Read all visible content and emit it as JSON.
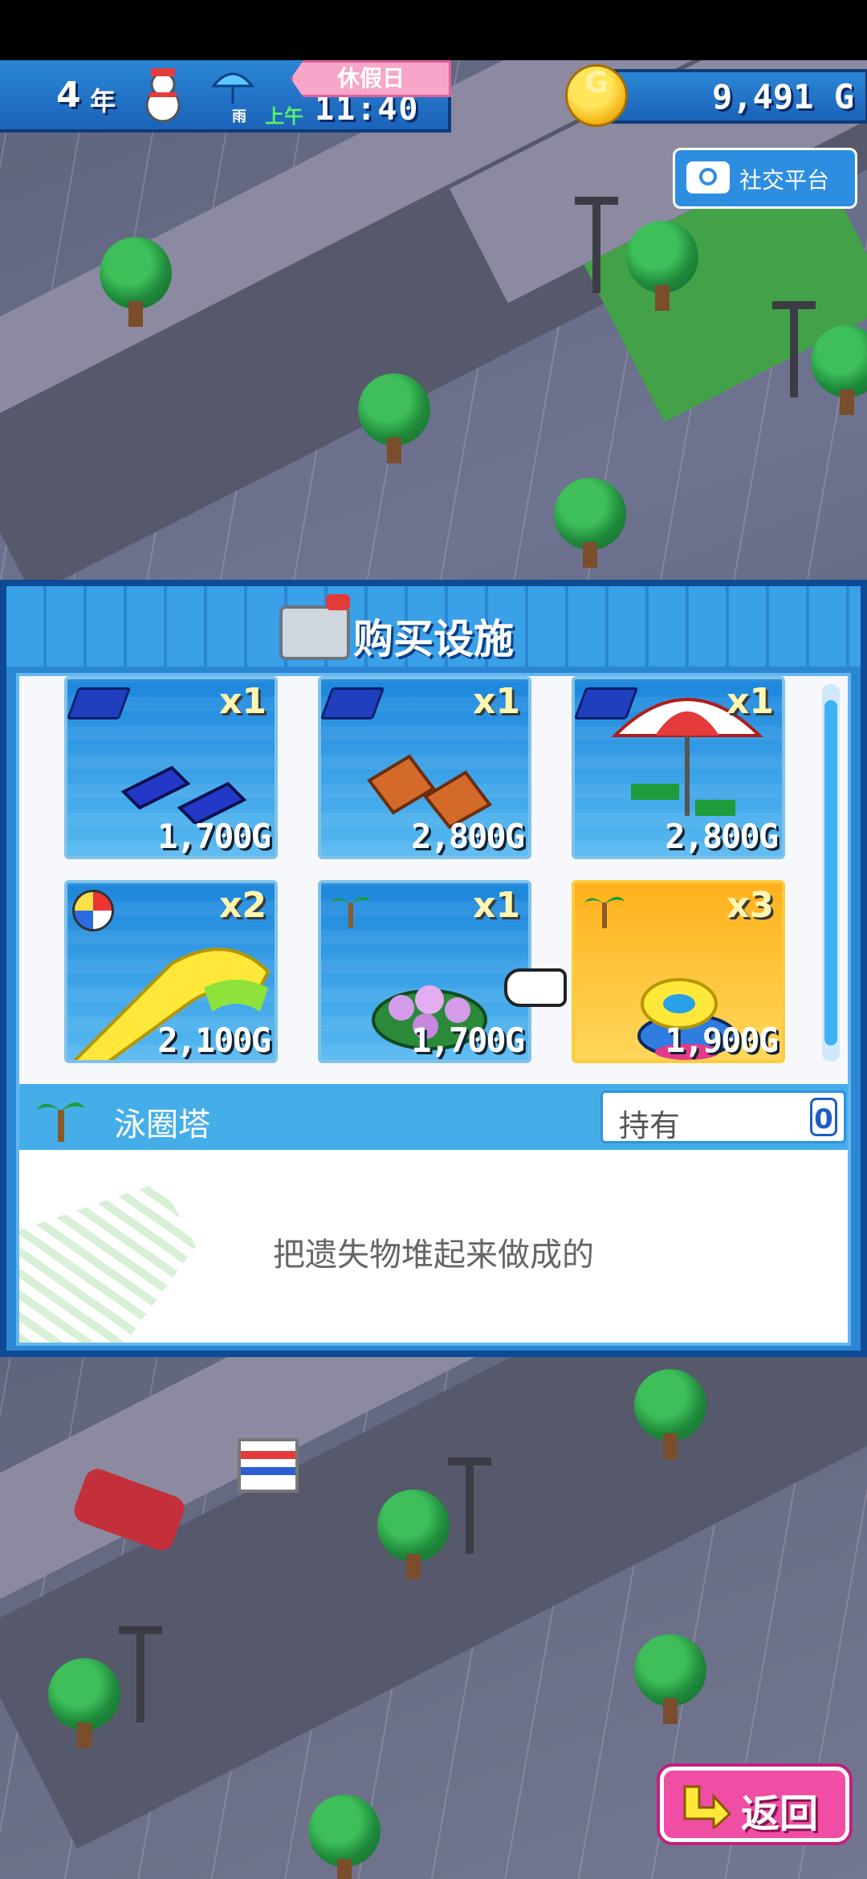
{
  "hud": {
    "year": "4",
    "year_unit": "年",
    "weather": "雨",
    "ampm": "上午",
    "time": "11:40",
    "holiday": "休假日",
    "money": "9,491 G",
    "coin_symbol": "G",
    "icons": [
      "snowman-icon",
      "umbrella-icon",
      "coin-icon"
    ]
  },
  "social": {
    "label": "社交平台",
    "icon": "camera-icon"
  },
  "modal": {
    "title": "购买设施",
    "items": [
      {
        "qty": "x1",
        "price": "1,700G",
        "category_icon": "beach-chair-icon"
      },
      {
        "qty": "x1",
        "price": "2,800G",
        "category_icon": "beach-chair-icon"
      },
      {
        "qty": "x1",
        "price": "2,800G",
        "category_icon": "beach-chair-icon"
      },
      {
        "qty": "x2",
        "price": "2,100G",
        "category_icon": "beach-ball-icon"
      },
      {
        "qty": "x1",
        "price": "1,700G",
        "category_icon": "palm-tree-icon"
      },
      {
        "qty": "x3",
        "price": "1,900G",
        "category_icon": "palm-tree-icon",
        "selected": true
      }
    ],
    "selected_name": "泳圈塔",
    "owned_label": "持有",
    "owned_count": "0",
    "description": "把遗失物堆起来做成的"
  },
  "back_button": {
    "label": "返回",
    "icon": "back-arrow-icon"
  },
  "colors": {
    "hud_blue": "#1b63b8",
    "holiday_pink": "#f7a6c9",
    "modal_blue": "#2b87d3",
    "selected_orange": "#ffb11d",
    "back_pink": "#f04da4"
  }
}
